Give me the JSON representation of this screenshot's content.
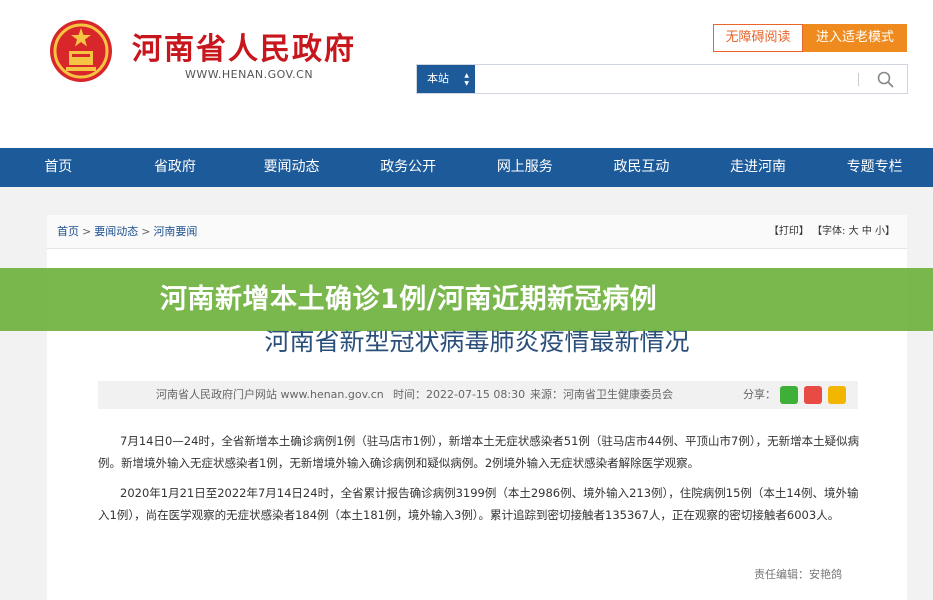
{
  "header": {
    "site_title": "河南省人民政府",
    "site_url": "WWW.HENAN.GOV.CN",
    "a11y_button": "无障碍阅读",
    "elder_button": "进入适老模式",
    "search_scope": "本站",
    "search_placeholder": ""
  },
  "nav": {
    "items": [
      "首页",
      "省政府",
      "要闻动态",
      "政务公开",
      "网上服务",
      "政民互动",
      "走进河南",
      "专题专栏"
    ]
  },
  "breadcrumb": {
    "home": "首页",
    "sep": ">",
    "level1": "要闻动态",
    "level2": "河南要闻"
  },
  "tools": {
    "print": "【打印】",
    "font_label": "【字体:",
    "large": "大",
    "medium": "中",
    "small": "小",
    "close": "】"
  },
  "banner": {
    "text": "河南新增本土确诊1例/河南近期新冠病例"
  },
  "article": {
    "title": "河南省新型冠状病毒肺炎疫情最新情况",
    "source": "河南省人民政府门户网站 www.henan.gov.cn",
    "time": "时间：2022-07-15 08:30",
    "origin": "来源：河南省卫生健康委员会",
    "share_label": "分享：",
    "paragraphs": [
      "7月14日0—24时，全省新增本土确诊病例1例（驻马店市1例），新增本土无症状感染者51例（驻马店市44例、平顶山市7例），无新增本土疑似病例。新增境外输入无症状感染者1例，无新增境外输入确诊病例和疑似病例。2例境外输入无症状感染者解除医学观察。",
      "2020年1月21日至2022年7月14日24时，全省累计报告确诊病例3199例（本土2986例、境外输入213例），住院病例15例（本土14例、境外输入1例），尚在医学观察的无症状感染者184例（本土181例，境外输入3例）。累计追踪到密切接触者135367人，正在观察的密切接触者6003人。"
    ],
    "editor": "责任编辑：安艳鸽"
  },
  "colors": {
    "brand_red": "#c8161d",
    "nav_blue": "#1d5a9a",
    "orange": "#ef8b1e",
    "banner_green": "#70b240"
  }
}
